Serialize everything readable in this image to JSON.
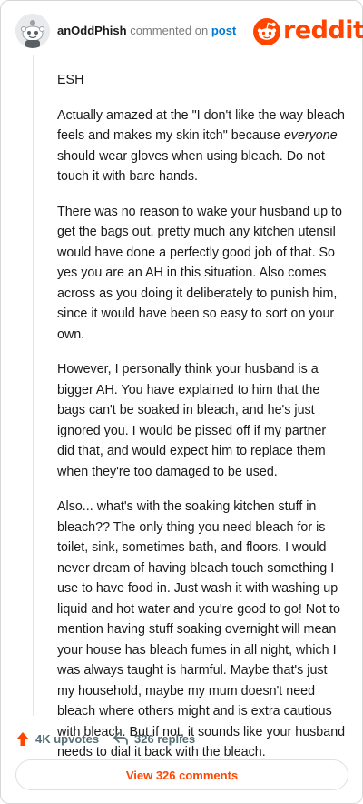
{
  "header": {
    "username": "anOddPhish",
    "action_text": "commented on",
    "post_link": "post",
    "logo_text": "reddit",
    "brand_color": "#ff4500"
  },
  "comment": {
    "paragraphs": [
      "ESH",
      "Actually amazed at the \"I don't like the way bleach feels and makes my skin itch\" because",
      "should wear gloves when using bleach. Do not touch it with bare hands.",
      "There was no reason to wake your husband up to get the bags out, pretty much any kitchen utensil would have done a perfectly good job of that. So yes you are an AH in this situation. Also comes across as you doing it deliberately to punish him, since it would have been so easy to sort on your own.",
      "However, I personally think your husband is a bigger AH. You have explained to him that the bags can't be soaked in bleach, and he's just ignored you. I would be pissed off if my partner did that, and would expect him to replace them when they're too damaged to be used.",
      "Also... what's with the soaking kitchen stuff in bleach?? The only thing you need bleach for is toilet, sink, sometimes bath, and floors. I would never dream of having bleach touch something I use to have food in. Just wash it with washing up liquid and hot water and you're good to go! Not to mention having stuff soaking overnight will mean your house has bleach fumes in all night, which I was always taught is harmful. Maybe that's just my household, maybe my mum doesn't need bleach where others might and is extra cautious with bleach. But if not, it sounds like your husband needs to dial it back with the bleach."
    ],
    "emphasis_word": "everyone"
  },
  "actions": {
    "upvotes": "4K upvotes",
    "replies": "326 replies",
    "upvote_icon": "upvote-arrow-icon",
    "reply_icon": "reply-arrow-icon"
  },
  "view_button": {
    "label": "View 326 comments"
  }
}
